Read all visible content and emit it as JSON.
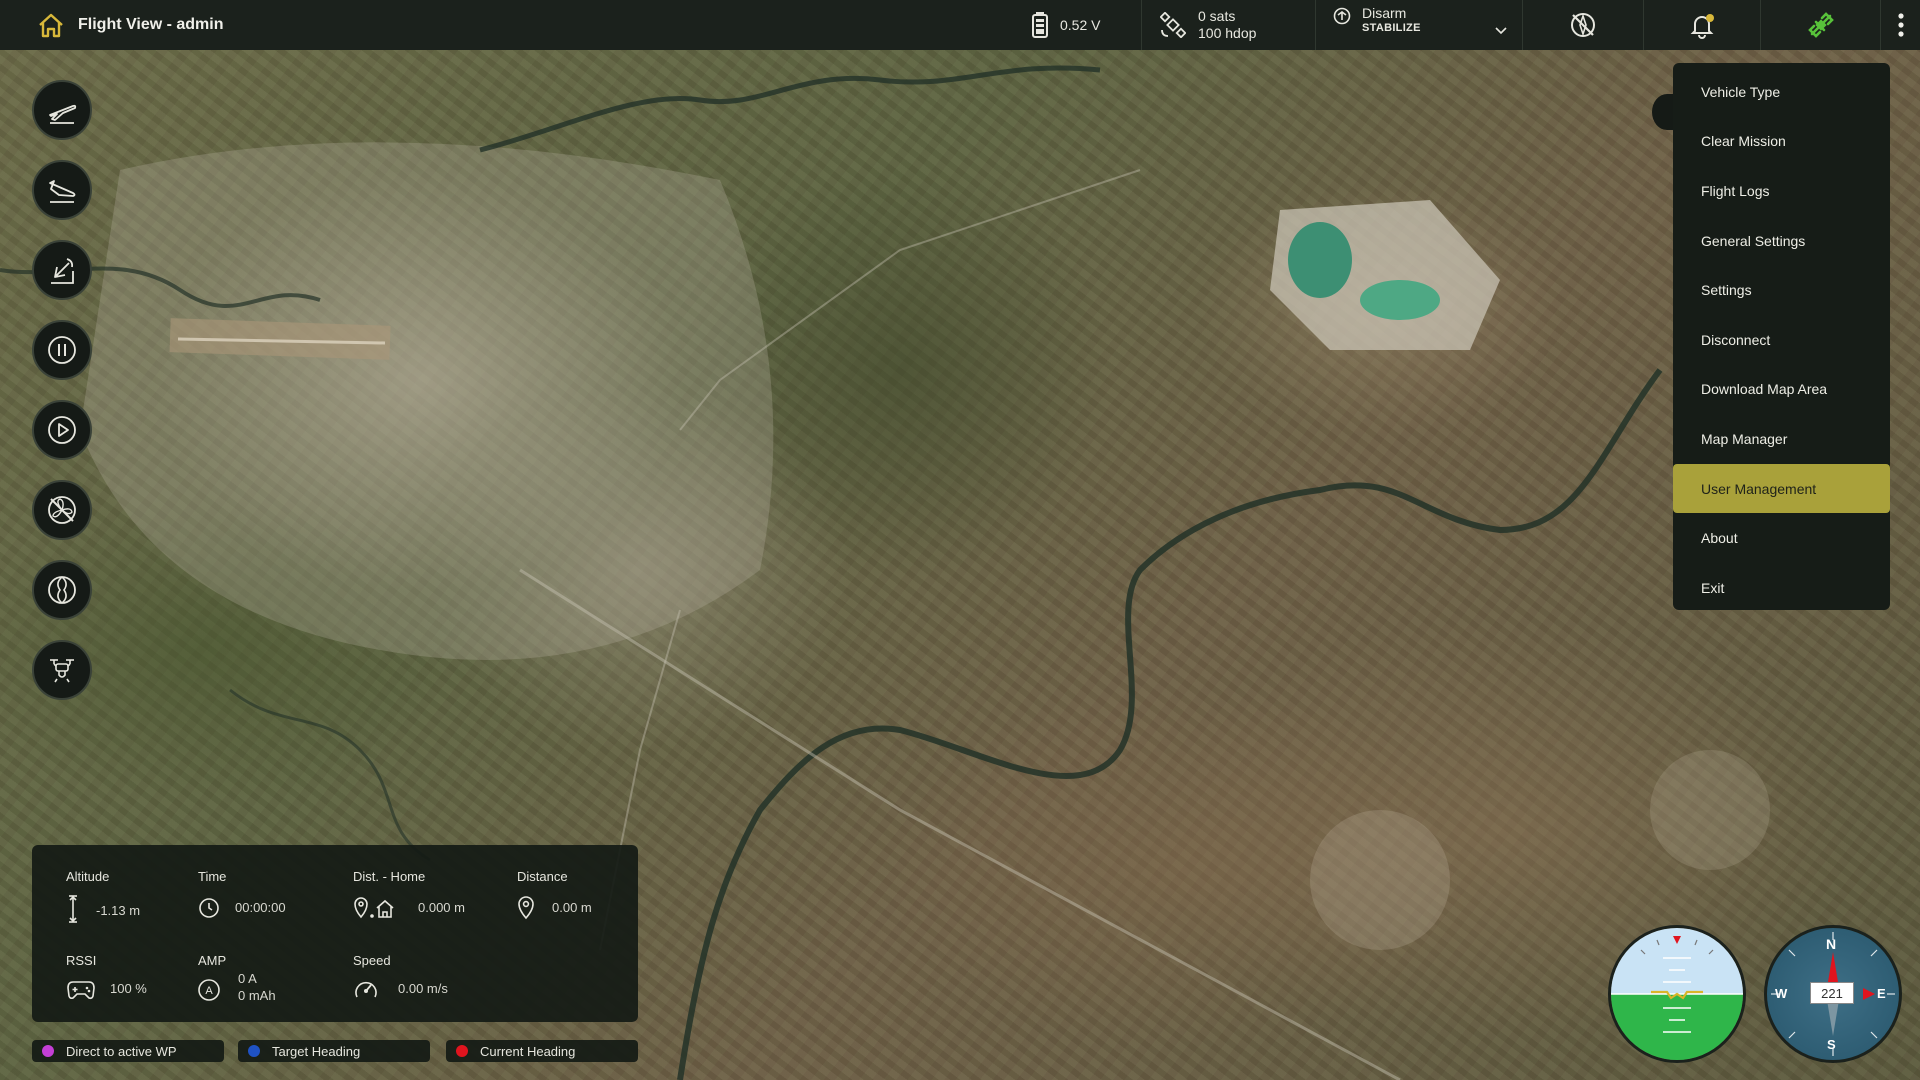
{
  "header": {
    "title": "Flight View - admin",
    "battery_voltage": "0.52 V",
    "gps_sats": "0 sats",
    "gps_hdop": "100 hdop",
    "arm_state": "Disarm",
    "flight_mode": "STABILIZE"
  },
  "menu": {
    "items": [
      "Vehicle Type",
      "Clear Mission",
      "Flight Logs",
      "General Settings",
      "Settings",
      "Disconnect",
      "Download Map Area",
      "Map Manager",
      "User Management",
      "About",
      "Exit"
    ],
    "active": "User Management"
  },
  "rail": {
    "buttons": [
      "takeoff-icon",
      "land-icon",
      "return-to-launch-icon",
      "pause-icon",
      "play-icon",
      "no-propeller-icon",
      "propeller-icon",
      "drone-icon"
    ]
  },
  "telemetry": {
    "altitude_label": "Altitude",
    "altitude_value": "-1.13 m",
    "time_label": "Time",
    "time_value": "00:00:00",
    "dist_home_label": "Dist. - Home",
    "dist_home_value": "0.000 m",
    "distance_label": "Distance",
    "distance_value": "0.00 m",
    "rssi_label": "RSSI",
    "rssi_value": "100 %",
    "amp_label": "AMP",
    "amp_current": "0 A",
    "amp_capacity": "0 mAh",
    "speed_label": "Speed",
    "speed_value": "0.00 m/s"
  },
  "legend": {
    "direct_wp": "Direct to active WP",
    "target_heading": "Target Heading",
    "current_heading": "Current Heading"
  },
  "instruments": {
    "heading": "221",
    "compass_n": "N",
    "compass_s": "S",
    "compass_e": "E",
    "compass_w": "W"
  },
  "colors": {
    "accent": "#a9a13a",
    "panel": "#161c17",
    "direct_wp": "#c43fd6",
    "target_heading": "#1f52c4",
    "current_heading": "#e0141e",
    "connected": "#58c23a"
  }
}
